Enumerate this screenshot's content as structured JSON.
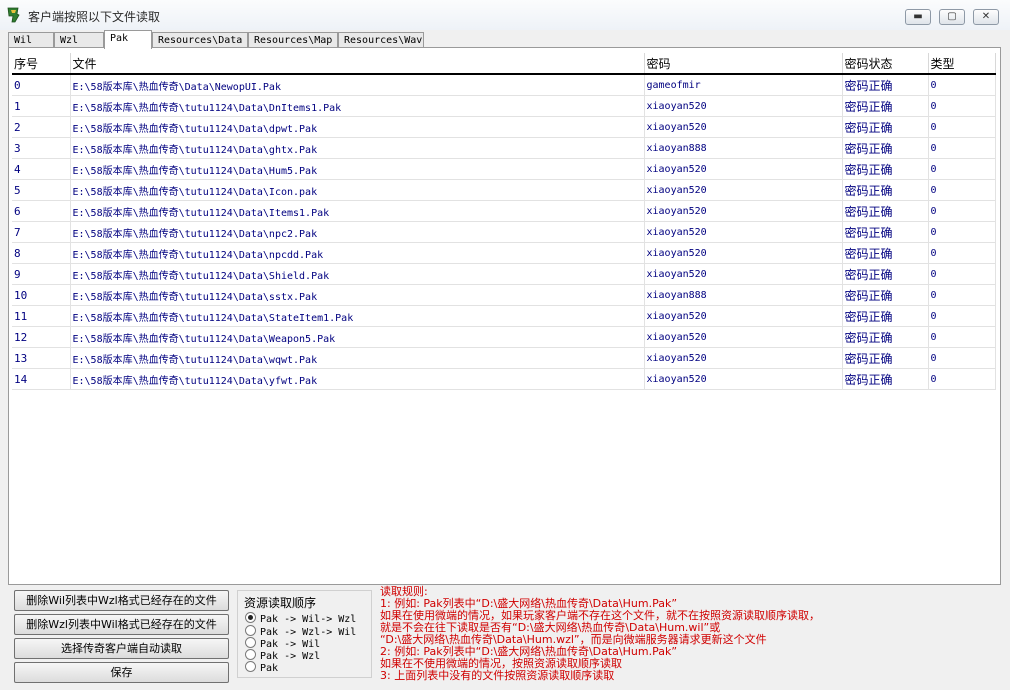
{
  "window": {
    "title": "客户端按照以下文件读取"
  },
  "tabs": [
    {
      "label": "Wil"
    },
    {
      "label": "Wzl"
    },
    {
      "label": "Pak"
    },
    {
      "label": "Resources\\Data"
    },
    {
      "label": "Resources\\Map"
    },
    {
      "label": "Resources\\Wav"
    }
  ],
  "table": {
    "columns": [
      "序号",
      "文件",
      "密码",
      "密码状态",
      "类型"
    ],
    "rows": [
      [
        "0",
        "E:\\58版本库\\热血传奇\\Data\\NewopUI.Pak",
        "gameofmir",
        "密码正确",
        "0"
      ],
      [
        "1",
        "E:\\58版本库\\热血传奇\\tutu1124\\Data\\DnItems1.Pak",
        "xiaoyan520",
        "密码正确",
        "0"
      ],
      [
        "2",
        "E:\\58版本库\\热血传奇\\tutu1124\\Data\\dpwt.Pak",
        "xiaoyan520",
        "密码正确",
        "0"
      ],
      [
        "3",
        "E:\\58版本库\\热血传奇\\tutu1124\\Data\\ghtx.Pak",
        "xiaoyan888",
        "密码正确",
        "0"
      ],
      [
        "4",
        "E:\\58版本库\\热血传奇\\tutu1124\\Data\\Hum5.Pak",
        "xiaoyan520",
        "密码正确",
        "0"
      ],
      [
        "5",
        "E:\\58版本库\\热血传奇\\tutu1124\\Data\\Icon.pak",
        "xiaoyan520",
        "密码正确",
        "0"
      ],
      [
        "6",
        "E:\\58版本库\\热血传奇\\tutu1124\\Data\\Items1.Pak",
        "xiaoyan520",
        "密码正确",
        "0"
      ],
      [
        "7",
        "E:\\58版本库\\热血传奇\\tutu1124\\Data\\npc2.Pak",
        "xiaoyan520",
        "密码正确",
        "0"
      ],
      [
        "8",
        "E:\\58版本库\\热血传奇\\tutu1124\\Data\\npcdd.Pak",
        "xiaoyan520",
        "密码正确",
        "0"
      ],
      [
        "9",
        "E:\\58版本库\\热血传奇\\tutu1124\\Data\\Shield.Pak",
        "xiaoyan520",
        "密码正确",
        "0"
      ],
      [
        "10",
        "E:\\58版本库\\热血传奇\\tutu1124\\Data\\sstx.Pak",
        "xiaoyan888",
        "密码正确",
        "0"
      ],
      [
        "11",
        "E:\\58版本库\\热血传奇\\tutu1124\\Data\\StateItem1.Pak",
        "xiaoyan520",
        "密码正确",
        "0"
      ],
      [
        "12",
        "E:\\58版本库\\热血传奇\\tutu1124\\Data\\Weapon5.Pak",
        "xiaoyan520",
        "密码正确",
        "0"
      ],
      [
        "13",
        "E:\\58版本库\\热血传奇\\tutu1124\\Data\\wqwt.Pak",
        "xiaoyan520",
        "密码正确",
        "0"
      ],
      [
        "14",
        "E:\\58版本库\\热血传奇\\tutu1124\\Data\\yfwt.Pak",
        "xiaoyan520",
        "密码正确",
        "0"
      ]
    ]
  },
  "buttons": {
    "delete_wil": "删除Wil列表中Wzl格式已经存在的文件",
    "delete_wzl": "删除Wzl列表中Wil格式已经存在的文件",
    "auto_read": "选择传奇客户端自动读取",
    "save": "保存"
  },
  "load_order": {
    "title": "资源读取顺序",
    "options": [
      "Pak -> Wil-> Wzl",
      "Pak -> Wzl-> Wil",
      "Pak -> Wil",
      "Pak -> Wzl",
      "Pak"
    ],
    "selected": 0
  },
  "rules": [
    "读取规则:",
    "1: 例如: Pak列表中“D:\\盛大网络\\热血传奇\\Data\\Hum.Pak”",
    "    如果在使用微端的情况，如果玩家客户端不存在这个文件，就不在按照资源读取顺序读取，",
    "    就是不会在往下读取是否有“D:\\盛大网络\\热血传奇\\Data\\Hum.wil”或",
    "  “D:\\盛大网络\\热血传奇\\Data\\Hum.wzl”，而是向微端服务器请求更新这个文件",
    "2: 例如: Pak列表中“D:\\盛大网络\\热血传奇\\Data\\Hum.Pak”",
    "    如果在不使用微端的情况，按照资源读取顺序读取",
    "3: 上面列表中没有的文件按照资源读取顺序读取"
  ],
  "colors": {
    "link_text": "#000080",
    "rules_text": "#d00000"
  }
}
